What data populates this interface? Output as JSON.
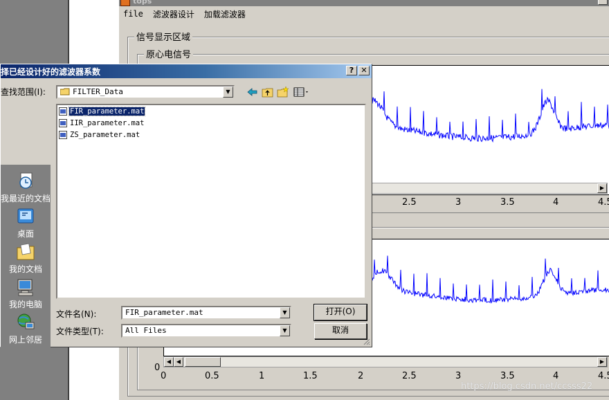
{
  "background_window": {
    "title": "tops",
    "menu": [
      "file",
      "滤波器设计",
      "加载滤波器"
    ],
    "display_area_label": "信号显示区域",
    "panel1_label": "原心电信号",
    "axes1": {
      "x_ticks": [
        "2.5",
        "3",
        "3.5",
        "4",
        "4.5"
      ]
    },
    "axes2": {
      "zero_label": "0",
      "x_ticks": [
        "0",
        "0.5",
        "1",
        "1.5",
        "2",
        "2.5",
        "3",
        "3.5",
        "4",
        "4.5"
      ]
    }
  },
  "dialog": {
    "title": "择已经设计好的滤波器系数",
    "help_btn": "?",
    "close_btn": "✕",
    "look_in_label": "查找范围(I):",
    "look_in_value": "FILTER_Data",
    "places": [
      {
        "label": "我最近的文档",
        "icon": "recent-documents-icon"
      },
      {
        "label": "桌面",
        "icon": "desktop-icon"
      },
      {
        "label": "我的文档",
        "icon": "my-documents-icon"
      },
      {
        "label": "我的电脑",
        "icon": "my-computer-icon"
      },
      {
        "label": "网上邻居",
        "icon": "network-places-icon"
      }
    ],
    "files": [
      {
        "name": "FIR_parameter.mat",
        "selected": true
      },
      {
        "name": "IIR_parameter.mat",
        "selected": false
      },
      {
        "name": "ZS_parameter.mat",
        "selected": false
      }
    ],
    "file_name_label": "文件名(N):",
    "file_name_value": "FIR_parameter.mat",
    "file_type_label": "文件类型(T):",
    "file_type_value": "All Files",
    "open_button": "打开(O)",
    "cancel_button": "取消"
  },
  "watermark": "https://blog.csdn.net/ccsss22",
  "colors": {
    "signal": "#0000ff",
    "title_gradient_start": "#0a246a",
    "title_gradient_end": "#a6caf0",
    "selection": "#0a246a"
  }
}
